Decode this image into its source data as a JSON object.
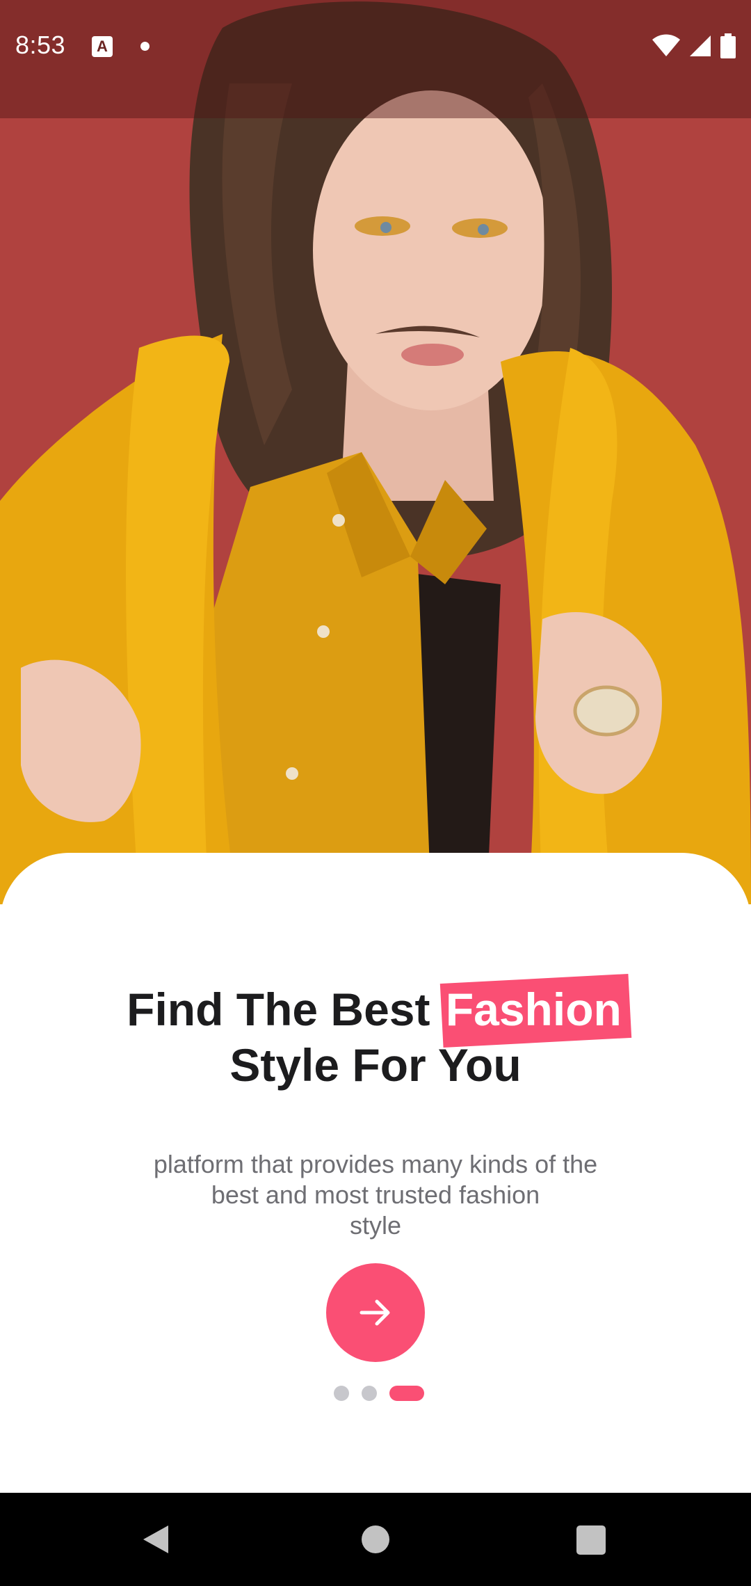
{
  "status_bar": {
    "time": "8:53",
    "icons": [
      "a-notification-icon",
      "dot-icon",
      "wifi-icon",
      "signal-icon",
      "battery-icon"
    ]
  },
  "hero": {
    "image": "fashion-model-photo",
    "colors": {
      "background": "#b0423f",
      "coat": "#e0a010"
    }
  },
  "onboarding": {
    "title_line1_prefix": "Find The Best ",
    "title_highlight": "Fashion",
    "title_line2": "Style For You",
    "subtitle_line1": "platform that provides many kinds of the",
    "subtitle_line2": "best and most trusted fashion",
    "subtitle_line3": "style",
    "next_button_icon": "arrow-right-icon",
    "page_indicator": {
      "total": 3,
      "active_index": 2
    },
    "accent_color": "#fa4f74"
  },
  "nav_bar": {
    "buttons": [
      "back-icon",
      "home-icon",
      "recents-icon"
    ]
  }
}
